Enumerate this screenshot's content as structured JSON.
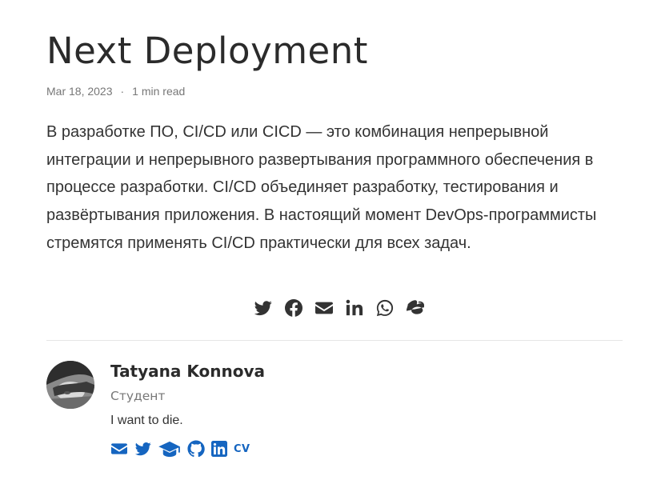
{
  "post": {
    "title": "Next Deployment",
    "date": "Mar 18, 2023",
    "separator": "·",
    "reading_time": "1 min read",
    "summary": "В разработке ПО, CI/CD или CICD — это комбинация непрерывной интеграции и непрерывного развертывания программного обеспечения в процессе разработки. CI/CD объединяет разработку, тестирования и развёртывания приложения. В настоящий момент DevOps-программисты стремятся применять CI/CD практически для всех задач."
  },
  "share_icons": [
    "twitter-icon",
    "facebook-icon",
    "envelope-icon",
    "linkedin-icon",
    "whatsapp-icon",
    "weibo-icon"
  ],
  "author": {
    "name": "Tatyana Konnova",
    "role": "Студент",
    "bio": "I want to die.",
    "cv_label": "CV",
    "link_icons": [
      "envelope-icon",
      "twitter-icon",
      "graduation-cap-icon",
      "github-icon",
      "linkedin-icon",
      "cv-icon"
    ]
  },
  "colors": {
    "text": "#2b2b2b",
    "muted": "#777777",
    "accent": "#1565c0"
  }
}
